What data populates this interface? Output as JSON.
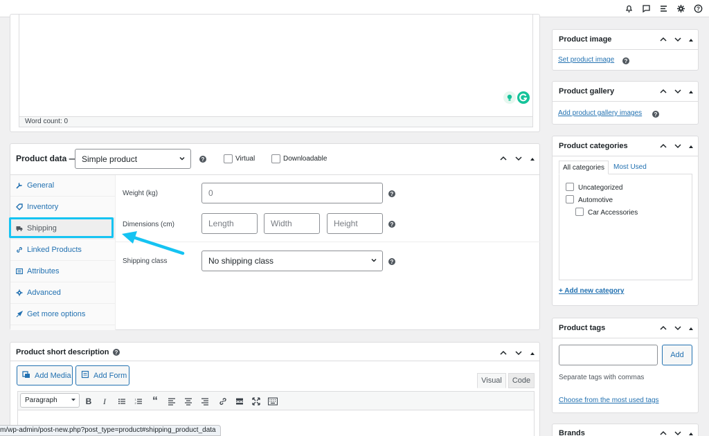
{
  "editor": {
    "word_count": "Word count: 0"
  },
  "product_data": {
    "title": "Product data —",
    "type_select": "Simple product",
    "virtual_label": "Virtual",
    "downloadable_label": "Downloadable",
    "tabs": [
      {
        "label": "General",
        "icon": "wrench-icon"
      },
      {
        "label": "Inventory",
        "icon": "tag-icon"
      },
      {
        "label": "Shipping",
        "icon": "truck-icon"
      },
      {
        "label": "Linked Products",
        "icon": "link-icon"
      },
      {
        "label": "Attributes",
        "icon": "list-icon"
      },
      {
        "label": "Advanced",
        "icon": "gear-icon"
      },
      {
        "label": "Get more options",
        "icon": "plugin-icon"
      }
    ],
    "weight_label": "Weight (kg)",
    "weight_placeholder": "0",
    "dimensions_label": "Dimensions (cm)",
    "length_placeholder": "Length",
    "width_placeholder": "Width",
    "height_placeholder": "Height",
    "shipping_class_label": "Shipping class",
    "shipping_class_value": "No shipping class"
  },
  "short_description": {
    "title": "Product short description",
    "add_media": "Add Media",
    "add_form": "Add Form",
    "visual_tab": "Visual",
    "code_tab": "Code",
    "format_select": "Paragraph"
  },
  "status_url": "m/wp-admin/post-new.php?post_type=product#shipping_product_data",
  "sidebar": {
    "product_image": {
      "title": "Product image",
      "link": "Set product image"
    },
    "product_gallery": {
      "title": "Product gallery",
      "link": "Add product gallery images"
    },
    "product_categories": {
      "title": "Product categories",
      "tab_all": "All categories",
      "tab_most_used": "Most Used",
      "items": [
        "Uncategorized",
        "Automotive",
        "Car Accessories"
      ],
      "add_link": "+ Add new category"
    },
    "product_tags": {
      "title": "Product tags",
      "add_button": "Add",
      "hint": "Separate tags with commas",
      "choose_link": "Choose from the most used tags"
    },
    "brands": {
      "title": "Brands"
    }
  },
  "colors": {
    "accent": "#2271b1",
    "highlight": "#15c3f2"
  }
}
